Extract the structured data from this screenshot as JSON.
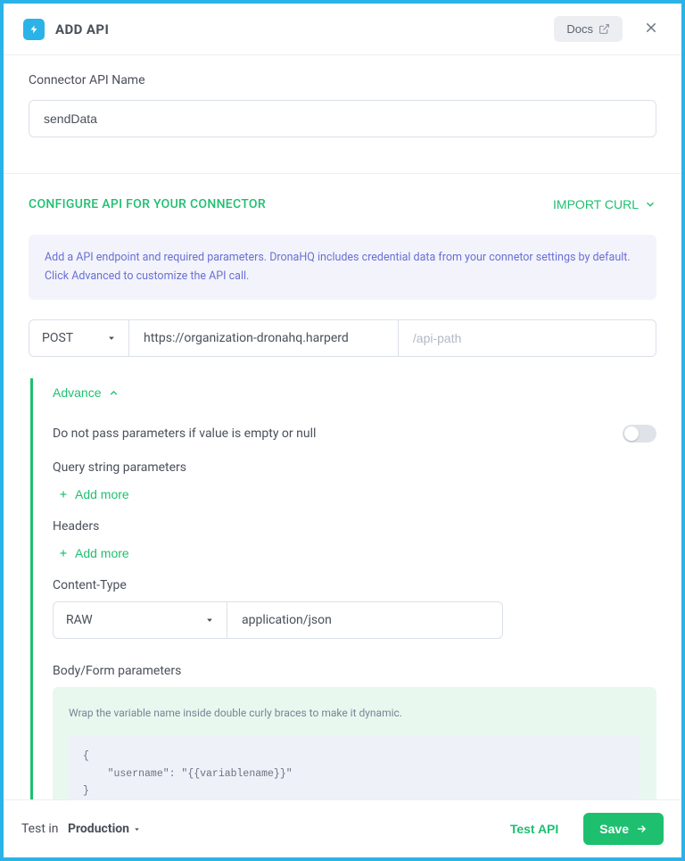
{
  "header": {
    "title": "ADD API",
    "docs_label": "Docs"
  },
  "name_section": {
    "label": "Connector API Name",
    "value": "sendData"
  },
  "configure": {
    "title": "CONFIGURE API FOR YOUR CONNECTOR",
    "import_label": "IMPORT CURL",
    "info": "Add a API endpoint and required parameters. DronaHQ includes credential data from your connetor settings by default. Click Advanced to customize the API call.",
    "method": "POST",
    "base_url": "https://organization-dronahq.harperd",
    "path_placeholder": "/api-path"
  },
  "advance": {
    "toggle_label": "Advance",
    "null_param_label": "Do not pass parameters if value is empty or null",
    "query_label": "Query string parameters",
    "headers_label": "Headers",
    "add_more_label": "Add more",
    "content_type_label": "Content-Type",
    "ct_format": "RAW",
    "ct_value": "application/json",
    "body_label": "Body/Form parameters",
    "body_info": "Wrap the variable name inside double curly braces to make it dynamic.",
    "body_example": "{\n    \"username\": \"{{variablename}}\"\n}"
  },
  "footer": {
    "test_in": "Test in",
    "env": "Production",
    "test_api": "Test API",
    "save": "Save"
  }
}
